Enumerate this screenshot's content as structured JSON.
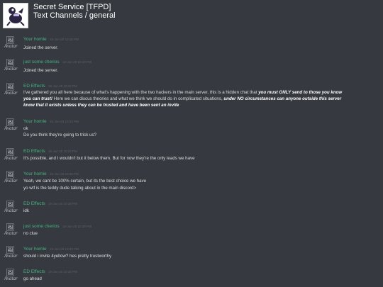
{
  "header": {
    "server_name": "Secret Service [TFPD]",
    "channel_path": "Text Channels / general"
  },
  "messages": [
    {
      "author": "Your homie",
      "time": "15-Jun-20 10:18 PM",
      "lines": [
        "Joined the server."
      ]
    },
    {
      "author": "just some cherios",
      "time": "15-Jun-20 10:19 PM",
      "lines": [
        "Joined the server."
      ]
    },
    {
      "author": "ED Effects",
      "time": "15-Jun-20 10:22 PM",
      "lines": [
        "I've gathered you all here because of what's happening with the two hackers in the main server, this is a hidden chat that",
        "you must ONLY send to those you know",
        "you can trust!",
        "Here we can discus theories and what we think we should do in complicated situations,",
        "under NO circumstances can anyone outside this server",
        "know that it exists unless they can be trusted and have been sent an invite"
      ]
    },
    {
      "author": "Your homie",
      "time": "15-Jun-20 10:23 PM",
      "lines": [
        "ok",
        "Do you think they're going to trick us?"
      ]
    },
    {
      "author": "ED Effects",
      "time": "15-Jun-20 10:24 PM",
      "lines": [
        "It's possible, and I wouldn't but it below them. But for now they're the only leads we have"
      ]
    },
    {
      "author": "Your homie",
      "time": "15-Jun-20 10:26 PM",
      "lines": [
        "Yeah, we cant be 100% certain, but its the best choice we have",
        "yo wtf is the teddy dude talking about in the main discord>"
      ]
    },
    {
      "author": "ED Effects",
      "time": "15-Jun-20 10:28 PM",
      "lines": [
        "idk"
      ]
    },
    {
      "author": "just some cherios",
      "time": "15-Jun-20 10:29 PM",
      "lines": [
        "no clue"
      ]
    },
    {
      "author": "Your homie",
      "time": "15-Jun-20 10:30 PM",
      "lines": [
        "should i invite 4yellow? hes pretty trustworthy"
      ]
    },
    {
      "author": "ED Effects",
      "time": "15-Jun-20 10:30 PM",
      "lines": [
        "go ahead"
      ]
    }
  ],
  "avatar_alt": "Avatar",
  "colors": {
    "background": "#36393f",
    "username": "#43b581",
    "text": "#dcddde",
    "timestamp": "#5d6068"
  },
  "icons": [
    "server-icon",
    "broken-image-icon"
  ]
}
